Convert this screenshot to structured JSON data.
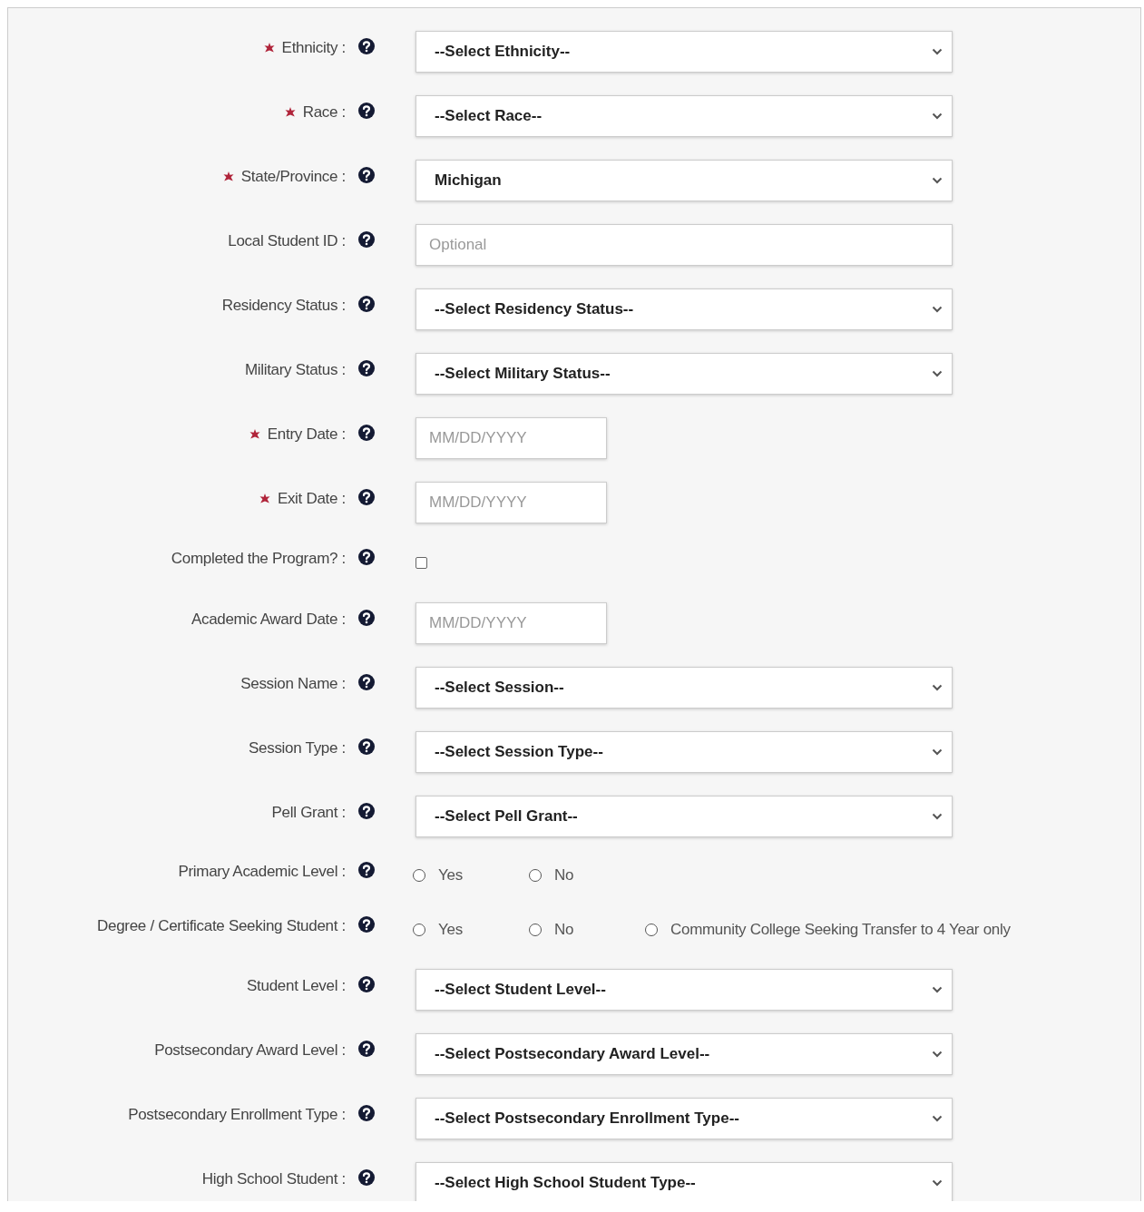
{
  "fields": [
    {
      "kind": "select",
      "label": "Ethnicity :",
      "required": true,
      "value": "--Select Ethnicity--"
    },
    {
      "kind": "select",
      "label": "Race :",
      "required": true,
      "value": "--Select Race--"
    },
    {
      "kind": "select",
      "label": "State/Province :",
      "required": true,
      "value": "Michigan"
    },
    {
      "kind": "text",
      "label": "Local Student ID :",
      "required": false,
      "placeholder": "Optional"
    },
    {
      "kind": "select",
      "label": "Residency Status :",
      "required": false,
      "value": "--Select Residency Status--"
    },
    {
      "kind": "select",
      "label": "Military Status :",
      "required": false,
      "value": "--Select Military Status--"
    },
    {
      "kind": "date",
      "label": "Entry Date :",
      "required": true,
      "placeholder": "MM/DD/YYYY"
    },
    {
      "kind": "date",
      "label": "Exit Date :",
      "required": true,
      "placeholder": "MM/DD/YYYY"
    },
    {
      "kind": "checkbox",
      "label": "Completed the Program? :",
      "required": false,
      "checked": false
    },
    {
      "kind": "date",
      "label": "Academic Award Date :",
      "required": false,
      "placeholder": "MM/DD/YYYY"
    },
    {
      "kind": "select",
      "label": "Session Name :",
      "required": false,
      "value": "--Select Session--"
    },
    {
      "kind": "select",
      "label": "Session Type :",
      "required": false,
      "value": "--Select Session Type--"
    },
    {
      "kind": "select",
      "label": "Pell Grant :",
      "required": false,
      "value": "--Select Pell Grant--"
    },
    {
      "kind": "radio",
      "label": "Primary Academic Level :",
      "required": false,
      "options": [
        {
          "label": "Yes",
          "selected": false
        },
        {
          "label": "No",
          "selected": false
        }
      ]
    },
    {
      "kind": "radio",
      "label": "Degree / Certificate Seeking Student :",
      "required": false,
      "options": [
        {
          "label": "Yes",
          "selected": false
        },
        {
          "label": "No",
          "selected": false
        },
        {
          "label": "Community College Seeking Transfer to 4 Year only",
          "selected": false
        }
      ]
    },
    {
      "kind": "select",
      "label": "Student Level :",
      "required": false,
      "value": "--Select Student Level--"
    },
    {
      "kind": "select",
      "label": "Postsecondary Award Level :",
      "required": false,
      "value": "--Select Postsecondary Award Level--"
    },
    {
      "kind": "select",
      "label": "Postsecondary Enrollment Type :",
      "required": false,
      "value": "--Select Postsecondary Enrollment Type--"
    },
    {
      "kind": "select",
      "label": "High School Student :",
      "required": false,
      "value": "--Select High School Student Type--"
    }
  ]
}
